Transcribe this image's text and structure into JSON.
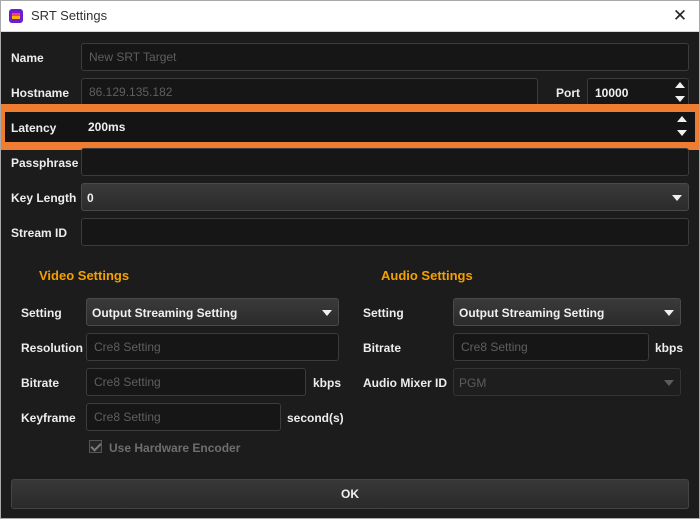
{
  "window": {
    "title": "SRT Settings",
    "close_glyph": "✕",
    "app_icon": "app-logo-icon"
  },
  "form": {
    "name_label": "Name",
    "name_placeholder": "New SRT Target",
    "hostname_label": "Hostname",
    "hostname_placeholder": "86.129.135.182",
    "port_label": "Port",
    "port_value": "10000",
    "latency_label": "Latency",
    "latency_value": "200ms",
    "passphrase_label": "Passphrase",
    "passphrase_value": "",
    "keylength_label": "Key Length",
    "keylength_value": "0",
    "streamid_label": "Stream ID",
    "streamid_value": ""
  },
  "video": {
    "heading": "Video Settings",
    "setting_label": "Setting",
    "setting_value": "Output Streaming Setting",
    "resolution_label": "Resolution",
    "resolution_placeholder": "Cre8 Setting",
    "bitrate_label": "Bitrate",
    "bitrate_placeholder": "Cre8 Setting",
    "bitrate_unit": "kbps",
    "keyframe_label": "Keyframe",
    "keyframe_placeholder": "Cre8 Setting",
    "keyframe_unit": "second(s)",
    "hw_encoder_label": "Use Hardware Encoder",
    "hw_encoder_checked": true
  },
  "audio": {
    "heading": "Audio Settings",
    "setting_label": "Setting",
    "setting_value": "Output Streaming Setting",
    "bitrate_label": "Bitrate",
    "bitrate_placeholder": "Cre8 Setting",
    "bitrate_unit": "kbps",
    "mixer_label": "Audio Mixer ID",
    "mixer_value": "PGM"
  },
  "ok_label": "OK",
  "colors": {
    "highlight": "#ee7d31",
    "section_heading": "#f5a000",
    "background": "#1c1c1c"
  }
}
